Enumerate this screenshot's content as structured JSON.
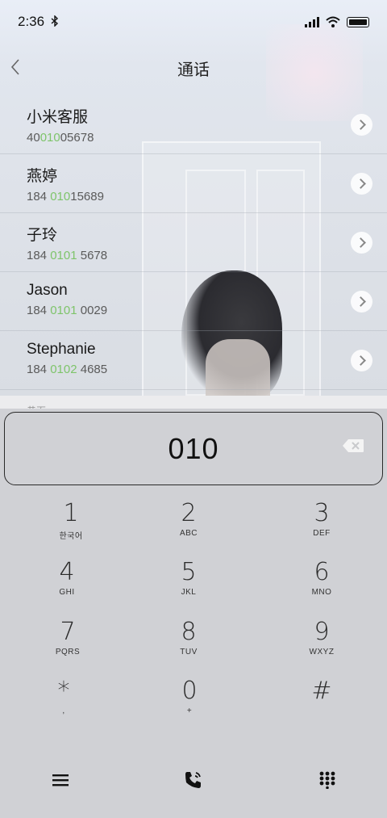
{
  "status_bar": {
    "time": "2:36"
  },
  "header": {
    "title": "通话"
  },
  "results": [
    {
      "name": "小米客服",
      "num_pre": "40",
      "num_hl": "010",
      "num_post": "05678"
    },
    {
      "name": "燕婷",
      "num_pre": "184 ",
      "num_hl": "010",
      "num_post": "15689"
    },
    {
      "name": "子玲",
      "num_pre": "184 ",
      "num_hl": "0101",
      "num_post": " 5678"
    },
    {
      "name": "Jason",
      "num_pre": "184 ",
      "num_hl": "0101",
      "num_post": " 0029"
    },
    {
      "name": "Stephanie",
      "num_pre": "184 ",
      "num_hl": "0102",
      "num_post": " 4685"
    }
  ],
  "section_partial": "黄页",
  "display": {
    "digits": "010"
  },
  "keys": [
    {
      "digit": "1",
      "letters": "한국어"
    },
    {
      "digit": "2",
      "letters": "ABC"
    },
    {
      "digit": "3",
      "letters": "DEF"
    },
    {
      "digit": "4",
      "letters": "GHI"
    },
    {
      "digit": "5",
      "letters": "JKL"
    },
    {
      "digit": "6",
      "letters": "MNO"
    },
    {
      "digit": "7",
      "letters": "PQRS"
    },
    {
      "digit": "8",
      "letters": "TUV"
    },
    {
      "digit": "9",
      "letters": "WXYZ"
    },
    {
      "digit": "*",
      "letters": ","
    },
    {
      "digit": "0",
      "letters": "+"
    },
    {
      "digit": "#",
      "letters": ""
    }
  ],
  "icons": {
    "menu": "menu-icon",
    "call": "phone-call-icon",
    "dialpad": "dialpad-icon",
    "backspace": "backspace-icon",
    "back": "chevron-left-icon"
  },
  "colors": {
    "highlight": "#7ec46a"
  }
}
